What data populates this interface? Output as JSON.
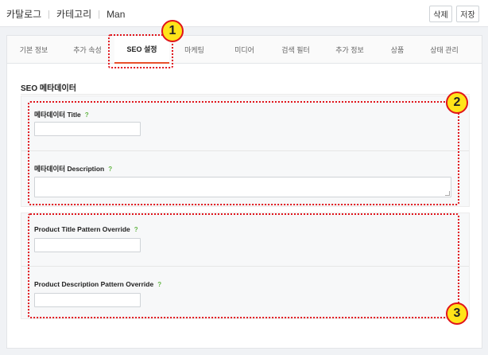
{
  "breadcrumb": {
    "items": [
      "카탈로그",
      "카테고리",
      "Man"
    ]
  },
  "actions": {
    "delete_label": "삭제",
    "save_label": "저장"
  },
  "tabs": [
    {
      "label": "기본 정보",
      "active": false
    },
    {
      "label": "추가 속성",
      "active": false
    },
    {
      "label": "SEO 설정",
      "active": true
    },
    {
      "label": "마케팅",
      "active": false
    },
    {
      "label": "미디어",
      "active": false
    },
    {
      "label": "검색 필터",
      "active": false
    },
    {
      "label": "추가 정보",
      "active": false
    },
    {
      "label": "상품",
      "active": false
    },
    {
      "label": "상태 관리",
      "active": false
    }
  ],
  "section": {
    "title": "SEO 메타데이터"
  },
  "fields": {
    "meta_title": {
      "label": "메타데이터 Title",
      "help": "?",
      "value": ""
    },
    "meta_description": {
      "label": "메타데이터 Description",
      "help": "?",
      "value": ""
    },
    "product_title_pattern": {
      "label": "Product Title Pattern Override",
      "help": "?",
      "value": ""
    },
    "product_description_pattern": {
      "label": "Product Description Pattern Override",
      "help": "?",
      "value": ""
    }
  },
  "callouts": [
    "1",
    "2",
    "3"
  ],
  "colors": {
    "accent": "#e8502c",
    "help": "#62b543",
    "callout_border": "#e0141b",
    "callout_fill": "#ffe419"
  }
}
